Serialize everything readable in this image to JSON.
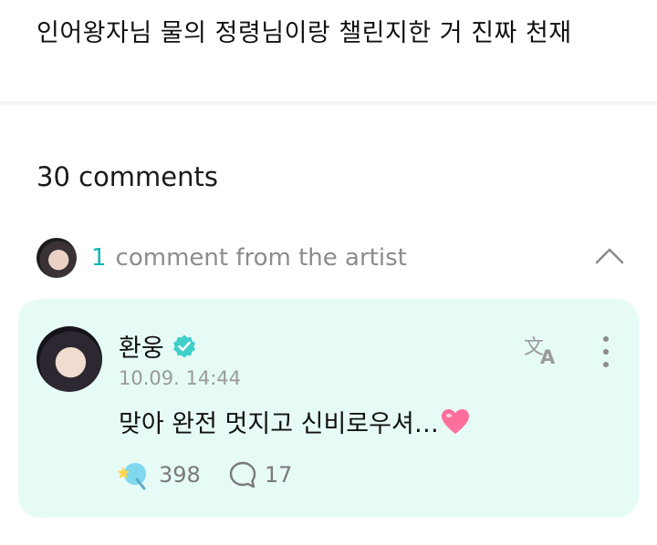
{
  "post": {
    "title": "인어왕자님 물의 정령님이랑 챌린지한 거 진짜 천재"
  },
  "comments_section": {
    "count_label": "30 comments",
    "artist_comments": {
      "count": "1",
      "label": "comment from the artist"
    }
  },
  "comment": {
    "author": "환웅",
    "verified": true,
    "timestamp": "10.09. 14:44",
    "text": "맞아 완전 멋지고 신비로우셔…",
    "emoji": "heart-icon",
    "likes": "398",
    "replies": "17"
  },
  "colors": {
    "accent": "#13b8b0",
    "card_background": "#e6faf6",
    "verified_badge": "#3fd0c9",
    "heart": "#ff6f9c"
  }
}
